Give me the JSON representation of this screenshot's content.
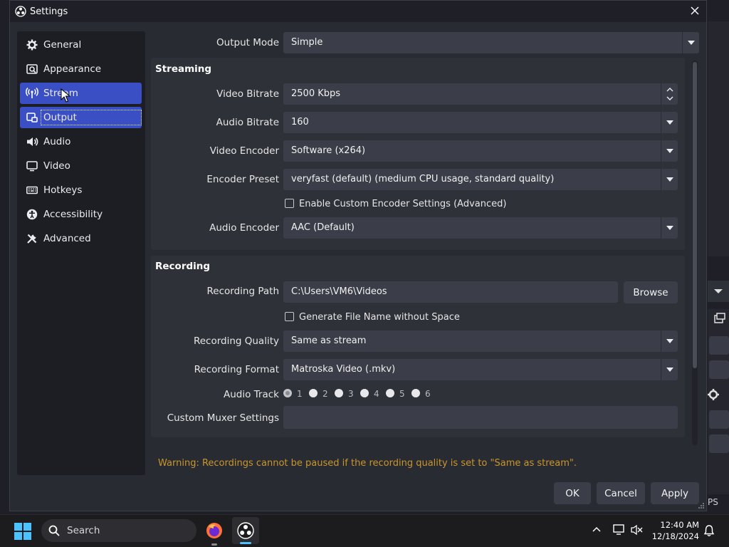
{
  "window": {
    "title": "Settings"
  },
  "sidebar": {
    "items": [
      {
        "label": "General",
        "icon": "gear-icon"
      },
      {
        "label": "Appearance",
        "icon": "appearance-icon"
      },
      {
        "label": "Stream",
        "icon": "antenna-icon"
      },
      {
        "label": "Output",
        "icon": "output-icon"
      },
      {
        "label": "Audio",
        "icon": "speaker-icon"
      },
      {
        "label": "Video",
        "icon": "monitor-icon"
      },
      {
        "label": "Hotkeys",
        "icon": "keyboard-icon"
      },
      {
        "label": "Accessibility",
        "icon": "accessibility-icon"
      },
      {
        "label": "Advanced",
        "icon": "tools-icon"
      }
    ],
    "selected": "Stream",
    "focused": "Output"
  },
  "output": {
    "mode_label": "Output Mode",
    "mode_value": "Simple"
  },
  "streaming": {
    "title": "Streaming",
    "video_bitrate_label": "Video Bitrate",
    "video_bitrate_value": "2500 Kbps",
    "audio_bitrate_label": "Audio Bitrate",
    "audio_bitrate_value": "160",
    "video_encoder_label": "Video Encoder",
    "video_encoder_value": "Software (x264)",
    "encoder_preset_label": "Encoder Preset",
    "encoder_preset_value": "veryfast (default) (medium CPU usage, standard quality)",
    "custom_encoder_label": "Enable Custom Encoder Settings (Advanced)",
    "audio_encoder_label": "Audio Encoder",
    "audio_encoder_value": "AAC (Default)"
  },
  "recording": {
    "title": "Recording",
    "path_label": "Recording Path",
    "path_value": "C:\\Users\\VM6\\Videos",
    "browse_label": "Browse",
    "filename_label": "Generate File Name without Space",
    "quality_label": "Recording Quality",
    "quality_value": "Same as stream",
    "format_label": "Recording Format",
    "format_value": "Matroska Video (.mkv)",
    "audio_track_label": "Audio Track",
    "audio_tracks": [
      "1",
      "2",
      "3",
      "4",
      "5",
      "6"
    ],
    "selected_track": "1",
    "muxer_label": "Custom Muxer Settings",
    "muxer_value": ""
  },
  "warning": "Warning: Recordings cannot be paused if the recording quality is set to \"Same as stream\".",
  "buttons": {
    "ok": "OK",
    "cancel": "Cancel",
    "apply": "Apply"
  },
  "background": {
    "fps_fragment": "PS"
  },
  "taskbar": {
    "search_placeholder": "Search",
    "time": "12:40 AM",
    "date": "12/18/2024"
  },
  "colors": {
    "accent": "#3a4fc4",
    "warning": "#c9962b",
    "dialog_bg": "#292b33",
    "field_bg": "#3b3d48"
  }
}
